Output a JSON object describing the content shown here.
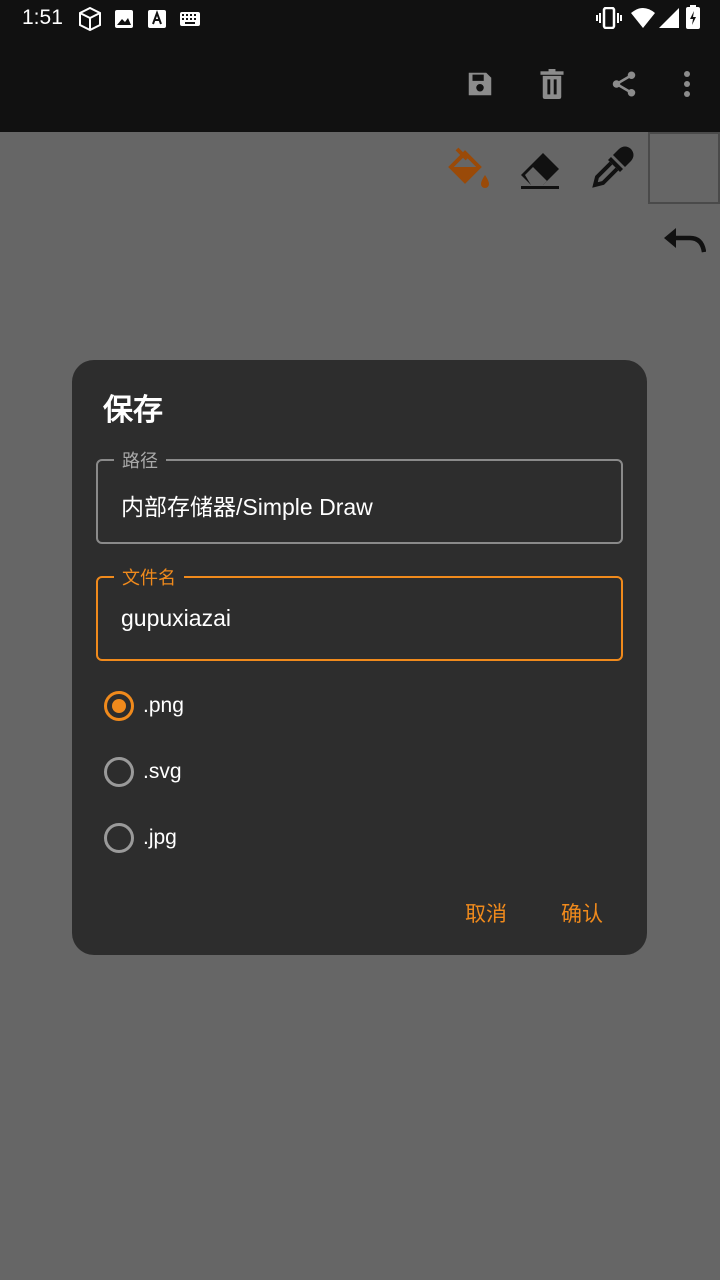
{
  "status_bar": {
    "time": "1:51",
    "left_icons": [
      "cube-icon",
      "image-icon",
      "font-icon",
      "keyboard-icon"
    ],
    "right_icons": [
      "vibrate-icon",
      "wifi-icon",
      "signal-icon",
      "battery-icon"
    ]
  },
  "app_bar": {
    "actions": [
      "save-icon",
      "delete-icon",
      "share-icon",
      "more-icon"
    ]
  },
  "tools": [
    "paint-bucket-icon",
    "eraser-icon",
    "eyedropper-icon"
  ],
  "colors": {
    "accent": "#f08a1c",
    "dialog_bg": "#2d2d2d",
    "canvas_bg": "#666666",
    "topbar_bg": "#111111",
    "bucket": "#9a4a08"
  },
  "dialog": {
    "title": "保存",
    "path_label": "路径",
    "path_value": "内部存储器/Simple Draw",
    "filename_label": "文件名",
    "filename_value": "gupuxiazai",
    "formats": [
      {
        "label": ".png",
        "checked": true
      },
      {
        "label": ".svg",
        "checked": false
      },
      {
        "label": ".jpg",
        "checked": false
      }
    ],
    "cancel_label": "取消",
    "confirm_label": "确认"
  }
}
